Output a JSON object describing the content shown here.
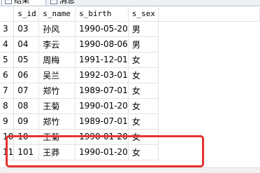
{
  "tabs": [
    {
      "label": "结果",
      "icon": "grid-icon"
    },
    {
      "label": "消息",
      "icon": "message-icon"
    }
  ],
  "columns": [
    "s_id",
    "s_name",
    "s_birth",
    "s_sex"
  ],
  "rows": [
    {
      "num": "3",
      "s_id": "03",
      "s_name": "孙风",
      "s_birth": "1990-05-20",
      "s_sex": "男"
    },
    {
      "num": "4",
      "s_id": "04",
      "s_name": "李云",
      "s_birth": "1990-08-06",
      "s_sex": "男"
    },
    {
      "num": "5",
      "s_id": "05",
      "s_name": "周梅",
      "s_birth": "1991-12-01",
      "s_sex": "女"
    },
    {
      "num": "6",
      "s_id": "06",
      "s_name": "吴兰",
      "s_birth": "1992-03-01",
      "s_sex": "女"
    },
    {
      "num": "7",
      "s_id": "07",
      "s_name": "郑竹",
      "s_birth": "1989-07-01",
      "s_sex": "女"
    },
    {
      "num": "8",
      "s_id": "08",
      "s_name": "王菊",
      "s_birth": "1990-01-20",
      "s_sex": "女"
    },
    {
      "num": "9",
      "s_id": "09",
      "s_name": "郑竹",
      "s_birth": "1989-07-01",
      "s_sex": "女"
    },
    {
      "num": "10",
      "s_id": "10",
      "s_name": "王菊",
      "s_birth": "1990-01-20",
      "s_sex": "女"
    },
    {
      "num": "11",
      "s_id": "101",
      "s_name": "王莽",
      "s_birth": "1990-01-20",
      "s_sex": "女"
    }
  ],
  "highlight_color": "#e8322f"
}
